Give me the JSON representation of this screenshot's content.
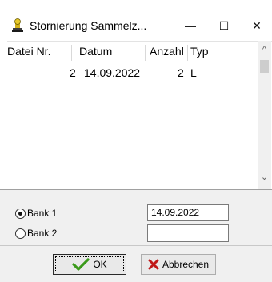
{
  "window": {
    "title": "Stornierung Sammelz...",
    "minimize_glyph": "—",
    "maximize_glyph": "☐",
    "close_glyph": "✕"
  },
  "list": {
    "columns": [
      "Datei Nr.",
      "Datum",
      "Anzahl",
      "Typ"
    ],
    "rows": [
      {
        "datei_nr": "2",
        "datum": "14.09.2022",
        "anzahl": "2",
        "typ": "L"
      }
    ]
  },
  "options": {
    "bank1_label": "Bank 1",
    "bank2_label": "Bank 2",
    "bank1_selected": true,
    "date_value": "14.09.2022",
    "second_value": ""
  },
  "buttons": {
    "ok_label": "OK",
    "cancel_label": "Abbrechen"
  },
  "icons": {
    "app": "stamp-icon",
    "ok": "checkmark-icon",
    "cancel": "x-icon"
  },
  "colors": {
    "ok_check": "#3a9a1a",
    "cancel_x": "#c01818",
    "panel_bg": "#f0f0f0"
  }
}
